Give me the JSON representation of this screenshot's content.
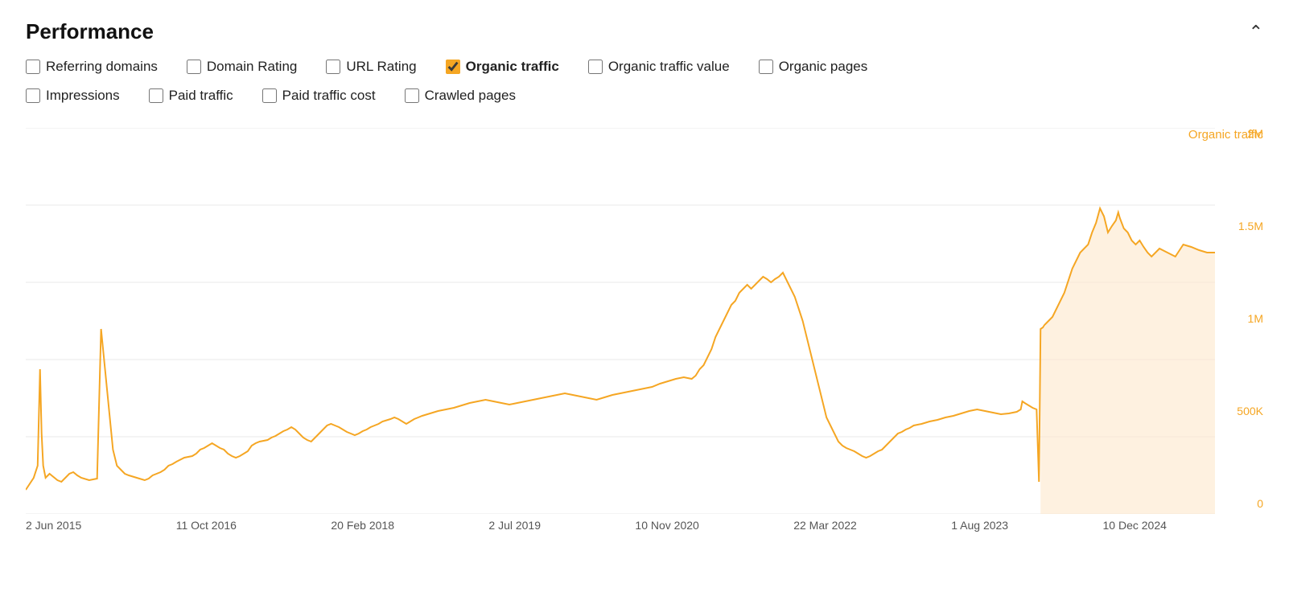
{
  "header": {
    "title": "Performance",
    "chevron": "chevron-up"
  },
  "checkboxes_row1": [
    {
      "id": "referring-domains",
      "label": "Referring domains",
      "checked": false
    },
    {
      "id": "domain-rating",
      "label": "Domain Rating",
      "checked": false
    },
    {
      "id": "url-rating",
      "label": "URL Rating",
      "checked": false
    },
    {
      "id": "organic-traffic",
      "label": "Organic traffic",
      "checked": true
    },
    {
      "id": "organic-traffic-value",
      "label": "Organic traffic value",
      "checked": false
    },
    {
      "id": "organic-pages",
      "label": "Organic pages",
      "checked": false
    }
  ],
  "checkboxes_row2": [
    {
      "id": "impressions",
      "label": "Impressions",
      "checked": false
    },
    {
      "id": "paid-traffic",
      "label": "Paid traffic",
      "checked": false
    },
    {
      "id": "paid-traffic-cost",
      "label": "Paid traffic cost",
      "checked": false
    },
    {
      "id": "crawled-pages",
      "label": "Crawled pages",
      "checked": false
    }
  ],
  "chart": {
    "legend_label": "Organic traffic",
    "y_labels": [
      "2M",
      "1.5M",
      "1M",
      "500K",
      "0"
    ],
    "x_labels": [
      "2 Jun 2015",
      "11 Oct 2016",
      "20 Feb 2018",
      "2 Jul 2019",
      "10 Nov 2020",
      "22 Mar 2022",
      "1 Aug 2023",
      "10 Dec 2024"
    ],
    "accent_color": "#f5a623"
  }
}
